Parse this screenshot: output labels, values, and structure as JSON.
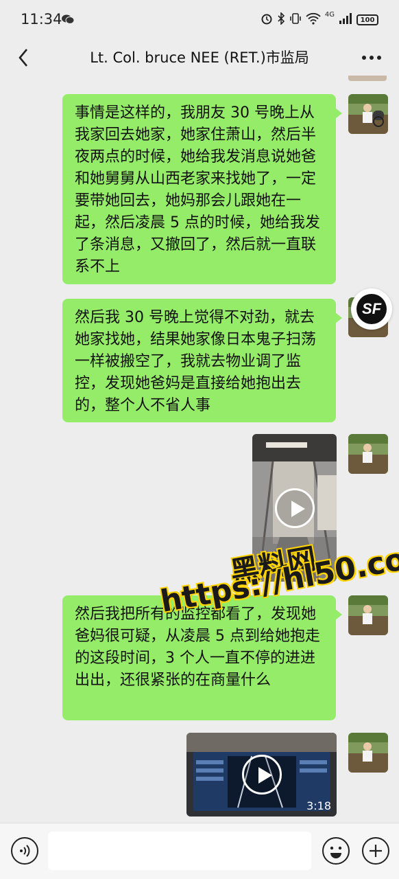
{
  "status_bar": {
    "time": "11:34",
    "network_label": "4G",
    "battery_level": "100"
  },
  "nav": {
    "title": "Lt. Col. bruce NEE (RET.)市监局"
  },
  "messages": [
    {
      "type": "text",
      "text": "事情是这样的，我朋友 30 号晚上从我家回去她家，她家住萧山，然后半夜两点的时候，她给我发消息说她爸和她舅舅从山西老家来找她了，一定要带她回去，她妈那会儿跟她在一起，然后凌晨 5 点的时候，她给我发了条消息，又撤回了，然后就一直联系不上"
    },
    {
      "type": "text",
      "text": "然后我 30 号晚上觉得不对劲，就去她家找她，结果她家像日本鬼子扫荡一样被搬空了，我就去物业调了监控，发现她爸妈是直接给她抱出去的，整个人不省人事"
    },
    {
      "type": "video"
    },
    {
      "type": "text",
      "text": "然后我把所有的监控都看了，发现她爸妈很可疑，从凌晨 5 点到给她抱走的这段时间，3 个人一直不停的进进出出，还很紧张的在商量什么"
    },
    {
      "type": "video",
      "duration": "3:18"
    }
  ],
  "badge": {
    "label": "SF"
  },
  "watermark": {
    "line1": "黑料网",
    "line2": "https://hl50.co"
  },
  "colors": {
    "bubble": "#95ec69",
    "background": "#ededed",
    "watermark_fill": "#ffd400"
  }
}
